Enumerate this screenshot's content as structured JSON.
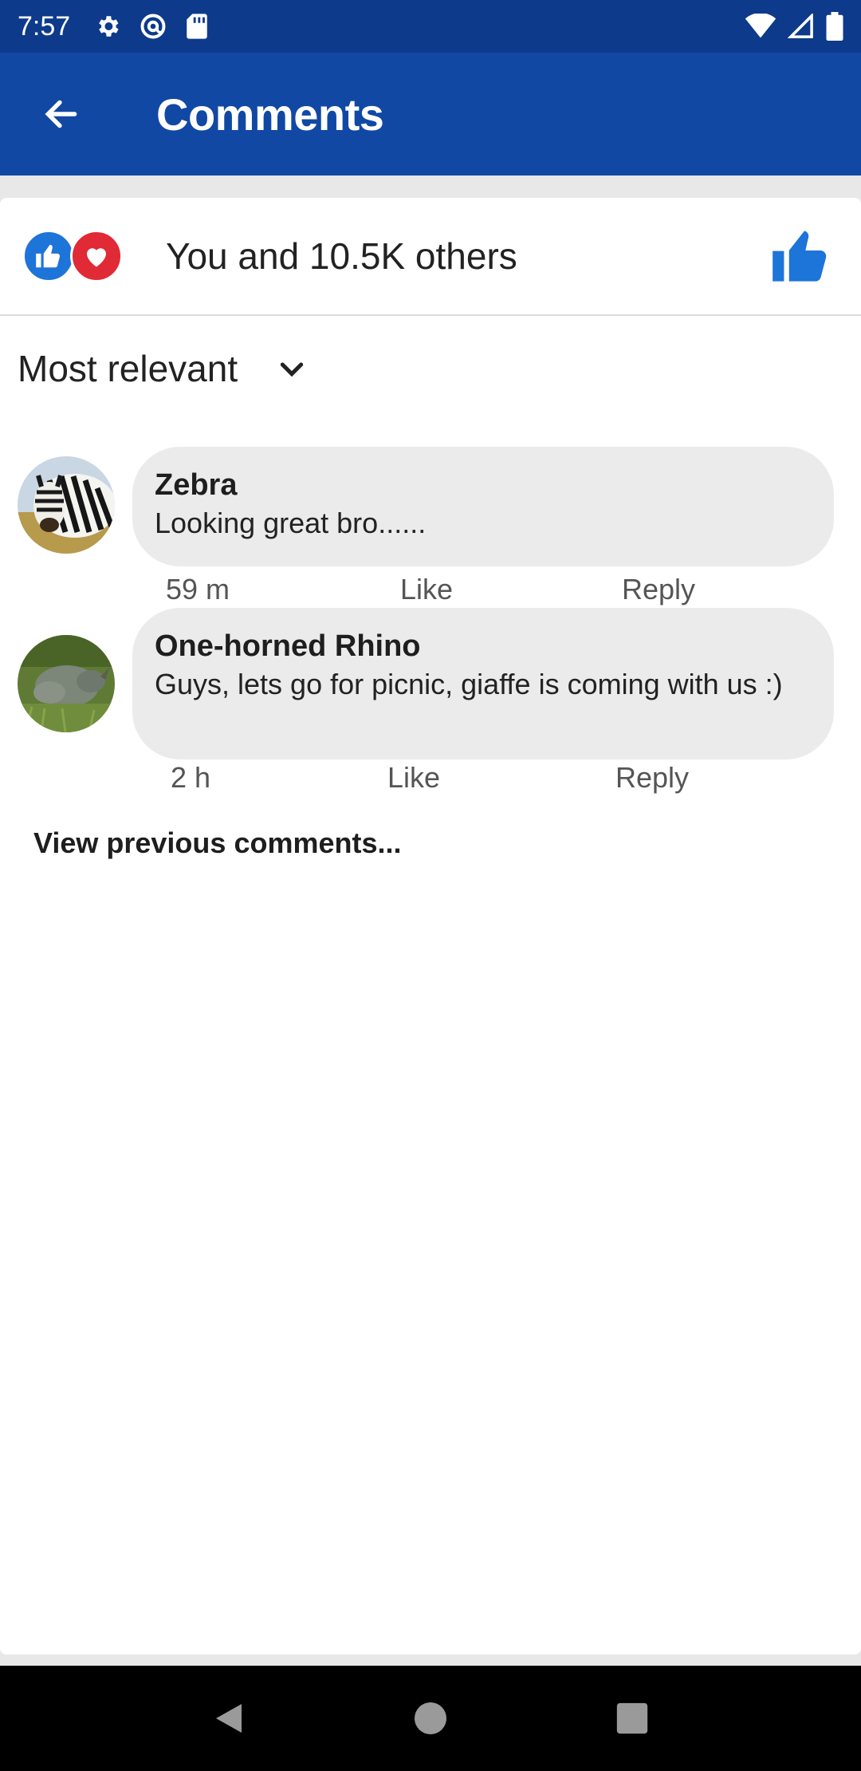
{
  "status_bar": {
    "time": "7:57",
    "icons_left": [
      "settings-icon",
      "at-sign-icon",
      "sd-card-icon"
    ],
    "icons_right": [
      "wifi-icon",
      "signal-icon",
      "battery-icon"
    ]
  },
  "app_bar": {
    "title": "Comments",
    "back_icon": "arrow-left-icon"
  },
  "reactions": {
    "summary": "You and 10.5K others",
    "icons": [
      "like-icon",
      "heart-icon"
    ],
    "like_action_icon": "thumbs-up-icon"
  },
  "sort": {
    "label": "Most relevant",
    "icon": "chevron-down-icon"
  },
  "comments": [
    {
      "author": "Zebra",
      "text": "Looking great bro......",
      "time": "59 m",
      "like_label": "Like",
      "reply_label": "Reply"
    },
    {
      "author": "One-horned Rhino",
      "text": "Guys, lets go for picnic, giaffe is coming with us :)",
      "time": "2 h",
      "like_label": "Like",
      "reply_label": "Reply"
    }
  ],
  "view_previous": "View previous comments...",
  "colors": {
    "status_bar": "#0d3a8a",
    "app_bar": "#1148a4",
    "like_blue": "#1d74d9",
    "love_red": "#e02a35",
    "bubble": "#ebebeb"
  },
  "nav_bar": {
    "icons": [
      "back-triangle-icon",
      "home-circle-icon",
      "recents-square-icon"
    ]
  }
}
